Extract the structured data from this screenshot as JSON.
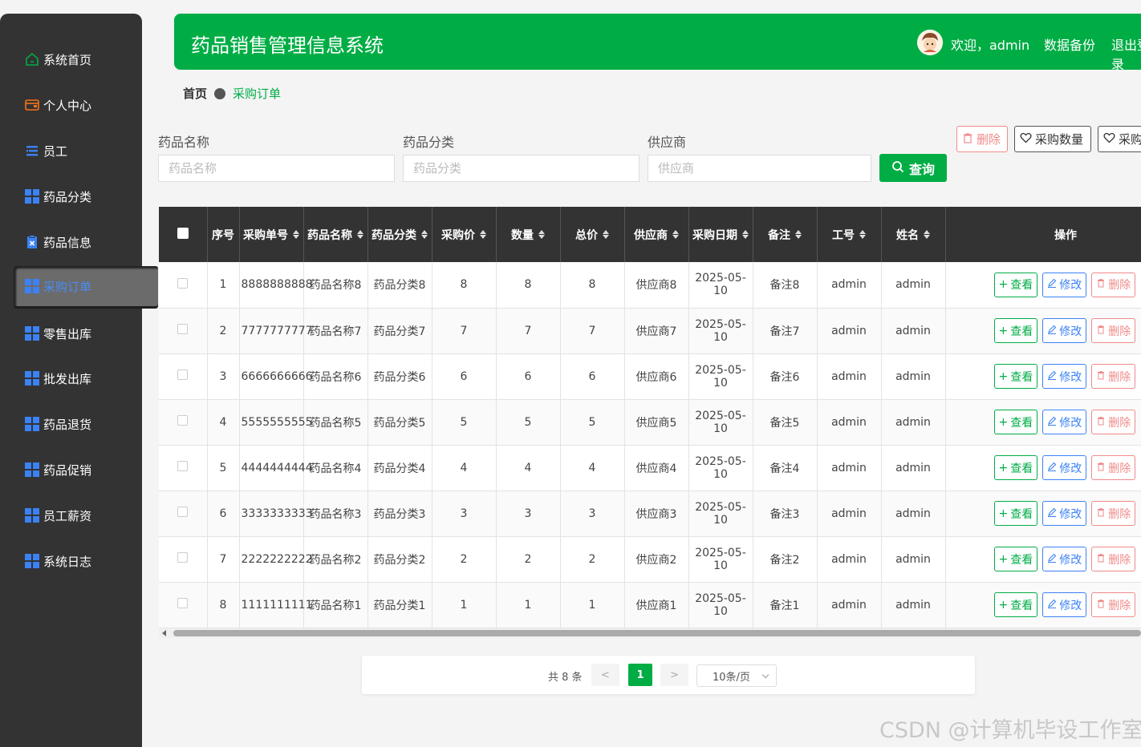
{
  "app_title": "药品销售管理信息系统",
  "header": {
    "welcome": "欢迎，admin",
    "backup": "数据备份",
    "logout": "退出登录"
  },
  "sidebar": {
    "items": [
      {
        "label": "系统首页",
        "icon": "home-icon"
      },
      {
        "label": "个人中心",
        "icon": "wallet-icon"
      },
      {
        "label": "员工",
        "icon": "list-icon"
      },
      {
        "label": "药品分类",
        "icon": "grid-icon"
      },
      {
        "label": "药品信息",
        "icon": "clipboard-icon"
      },
      {
        "label": "采购订单",
        "icon": "grid-icon",
        "active": true
      },
      {
        "label": "零售出库",
        "icon": "grid-icon"
      },
      {
        "label": "批发出库",
        "icon": "grid-icon"
      },
      {
        "label": "药品退货",
        "icon": "grid-icon"
      },
      {
        "label": "药品促销",
        "icon": "grid-icon"
      },
      {
        "label": "员工薪资",
        "icon": "grid-icon"
      },
      {
        "label": "系统日志",
        "icon": "grid-icon"
      }
    ]
  },
  "breadcrumb": {
    "home": "首页",
    "current": "采购订单"
  },
  "search": {
    "name_label": "药品名称",
    "name_placeholder": "药品名称",
    "category_label": "药品分类",
    "category_placeholder": "药品分类",
    "supplier_label": "供应商",
    "supplier_placeholder": "供应商",
    "query_label": "查询"
  },
  "toolbar": {
    "delete_label": "删除",
    "qty_label": "采购数量",
    "third_label": "采购金额"
  },
  "table": {
    "headers": [
      "序号",
      "采购单号",
      "药品名称",
      "药品分类",
      "采购价",
      "数量",
      "总价",
      "供应商",
      "采购日期",
      "备注",
      "工号",
      "姓名",
      "操作"
    ],
    "rows": [
      {
        "idx": "1",
        "order": "8888888888",
        "name": "药品名称8",
        "cat": "药品分类8",
        "price": "8",
        "qty": "8",
        "total": "8",
        "supplier": "供应商8",
        "date": "2025-05-10",
        "note": "备注8",
        "empno": "admin",
        "empname": "admin"
      },
      {
        "idx": "2",
        "order": "7777777777",
        "name": "药品名称7",
        "cat": "药品分类7",
        "price": "7",
        "qty": "7",
        "total": "7",
        "supplier": "供应商7",
        "date": "2025-05-10",
        "note": "备注7",
        "empno": "admin",
        "empname": "admin"
      },
      {
        "idx": "3",
        "order": "6666666666",
        "name": "药品名称6",
        "cat": "药品分类6",
        "price": "6",
        "qty": "6",
        "total": "6",
        "supplier": "供应商6",
        "date": "2025-05-10",
        "note": "备注6",
        "empno": "admin",
        "empname": "admin"
      },
      {
        "idx": "4",
        "order": "5555555555",
        "name": "药品名称5",
        "cat": "药品分类5",
        "price": "5",
        "qty": "5",
        "total": "5",
        "supplier": "供应商5",
        "date": "2025-05-10",
        "note": "备注5",
        "empno": "admin",
        "empname": "admin"
      },
      {
        "idx": "5",
        "order": "4444444444",
        "name": "药品名称4",
        "cat": "药品分类4",
        "price": "4",
        "qty": "4",
        "total": "4",
        "supplier": "供应商4",
        "date": "2025-05-10",
        "note": "备注4",
        "empno": "admin",
        "empname": "admin"
      },
      {
        "idx": "6",
        "order": "3333333333",
        "name": "药品名称3",
        "cat": "药品分类3",
        "price": "3",
        "qty": "3",
        "total": "3",
        "supplier": "供应商3",
        "date": "2025-05-10",
        "note": "备注3",
        "empno": "admin",
        "empname": "admin"
      },
      {
        "idx": "7",
        "order": "2222222222",
        "name": "药品名称2",
        "cat": "药品分类2",
        "price": "2",
        "qty": "2",
        "total": "2",
        "supplier": "供应商2",
        "date": "2025-05-10",
        "note": "备注2",
        "empno": "admin",
        "empname": "admin"
      },
      {
        "idx": "8",
        "order": "1111111111",
        "name": "药品名称1",
        "cat": "药品分类1",
        "price": "1",
        "qty": "1",
        "total": "1",
        "supplier": "供应商1",
        "date": "2025-05-10",
        "note": "备注1",
        "empno": "admin",
        "empname": "admin"
      }
    ],
    "actions": {
      "view": "查看",
      "edit": "修改",
      "delete": "删除"
    }
  },
  "pager": {
    "total": "共 8 条",
    "prev": "<",
    "current": "1",
    "next": ">",
    "size": "10条/页"
  },
  "watermark": "CSDN @计算机毕设工作室",
  "colors": {
    "primary": "#00ad45",
    "sidebar": "#333333",
    "link": "#3b82f6",
    "danger": "#f08a8a"
  }
}
